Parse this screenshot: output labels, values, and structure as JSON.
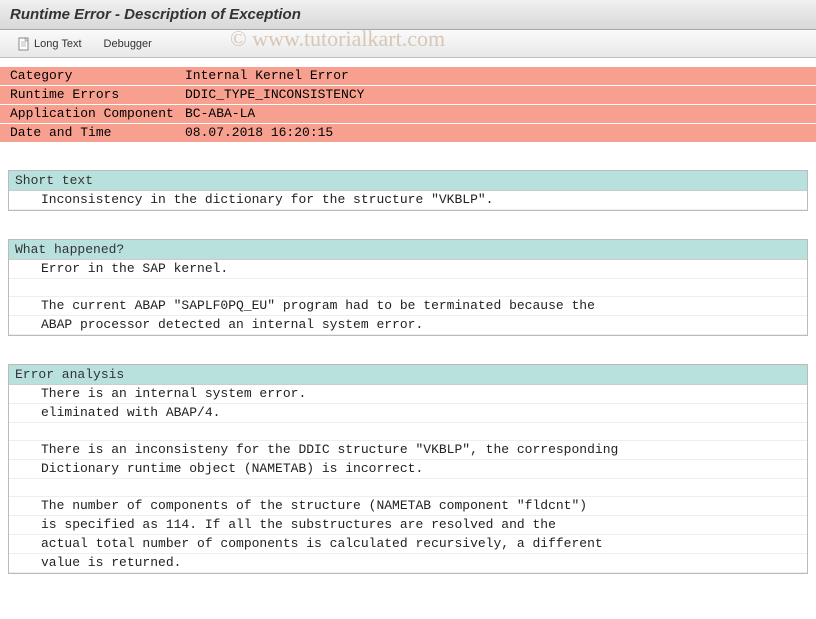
{
  "window": {
    "title": "Runtime Error - Description of Exception"
  },
  "toolbar": {
    "long_text_label": "Long Text",
    "debugger_label": "Debugger"
  },
  "category": {
    "rows": [
      {
        "label": "Category",
        "value": "Internal Kernel Error"
      },
      {
        "label": "Runtime Errors",
        "value": "DDIC_TYPE_INCONSISTENCY"
      },
      {
        "label": "Application Component",
        "value": "BC-ABA-LA"
      },
      {
        "label": "Date and Time",
        "value": "08.07.2018 16:20:15"
      }
    ]
  },
  "sections": [
    {
      "title": "Short text",
      "lines": [
        "Inconsistency in the dictionary for the structure \"VKBLP\"."
      ]
    },
    {
      "title": "What happened?",
      "lines": [
        "Error in the SAP kernel.",
        "",
        "The current ABAP \"SAPLF0PQ_EU\" program had to be terminated because the",
        "ABAP processor detected an internal system error."
      ]
    },
    {
      "title": "Error analysis",
      "lines": [
        "There is an internal system error.",
        "eliminated with ABAP/4.",
        "",
        "There is an inconsisteny for the DDIC structure \"VKBLP\", the corresponding",
        "Dictionary runtime object (NAMETAB) is incorrect.",
        "",
        "The number of components of the structure (NAMETAB component \"fldcnt\")",
        "is specified as 114. If all the substructures are resolved and the",
        "actual total number of components is calculated recursively, a different",
        "value is returned."
      ]
    }
  ],
  "watermark": "© www.tutorialkart.com"
}
